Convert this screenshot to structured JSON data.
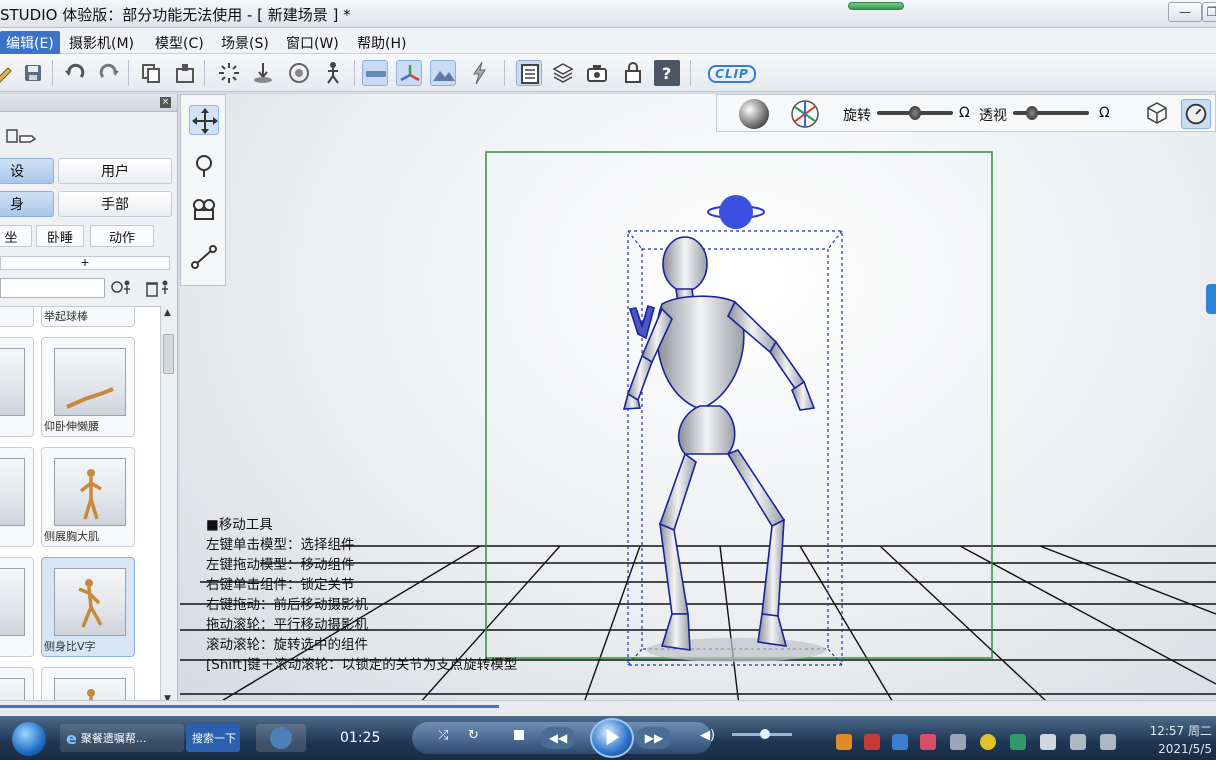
{
  "window": {
    "title": "STUDIO 体验版：部分功能无法使用 - [  新建场景  ] *",
    "minimize_symbol": "—",
    "restore_symbol": "❐"
  },
  "menubar": {
    "items": [
      {
        "label": "编辑(E)",
        "active": true
      },
      {
        "label": "摄影机(M)"
      },
      {
        "label": "模型(C)"
      },
      {
        "label": "场景(S)"
      },
      {
        "label": "窗口(W)"
      },
      {
        "label": "帮助(H)"
      }
    ]
  },
  "toolbar": {
    "logo_text": "CLIP",
    "icons": [
      "save-icon",
      "undo-icon",
      "redo-icon",
      "copy-icon",
      "paste-icon",
      "explode-icon",
      "ground-icon",
      "target-icon",
      "pose-icon",
      "ruler-icon",
      "axis-icon",
      "terrain-icon",
      "lightning-icon",
      "panel-icon",
      "layers-icon",
      "camera-icon",
      "lock-icon",
      "help-icon"
    ]
  },
  "left_panel": {
    "tabs_row1": [
      "设",
      "用户"
    ],
    "tabs_row2": [
      "身",
      "手部"
    ],
    "tabs_row3": [
      "坐",
      "卧睡",
      "动作"
    ],
    "plus": "+",
    "search_placeholder": "",
    "thumbnails": [
      {
        "caption": "举起球棒"
      },
      {
        "caption": "仰卧伸懒腰"
      },
      {
        "caption": "侧展胸大肌"
      },
      {
        "caption": "侧身比V字"
      },
      {
        "caption": ""
      }
    ]
  },
  "view_toolbar": {
    "rotate_label": "旋转",
    "perspective_label": "透视",
    "reset_symbol": "Ω",
    "rotate_level": 0.5,
    "perspective_level": 0.25
  },
  "hud": {
    "lines": [
      "■移动工具",
      "左键单击模型：选择组件",
      "左键拖动模型：移动组件",
      "右键单击组件：锁定关节",
      "右键拖动：前后移动摄影机",
      "拖动滚轮：平行移动摄影机",
      "滚动滚轮：旋转选中的组件",
      "[Shift]键＋滚动滚轮：以锁定的关节为支点旋转模型"
    ]
  },
  "taskbar": {
    "ie_label": "聚餐遗嘱帮...",
    "search_label": "搜索一下",
    "time_elapsed": "01:25",
    "progress": 0.41,
    "clock_time": "12:57 周二",
    "clock_date": "2021/5/5"
  }
}
